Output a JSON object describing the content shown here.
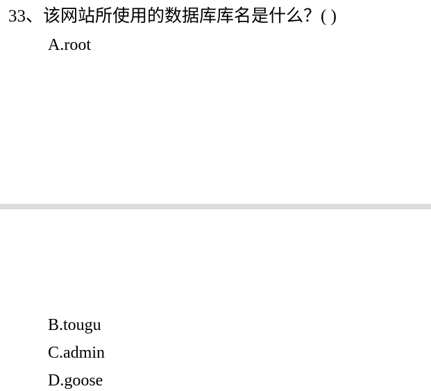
{
  "question": {
    "text": "33、该网站所使用的数据库库名是什么？(   )"
  },
  "options": [
    {
      "label": "A.root"
    },
    {
      "label": "B.tougu"
    },
    {
      "label": "C.admin"
    },
    {
      "label": "D.goose"
    }
  ],
  "colors": {
    "divider": "#dcdcdc",
    "text": "#000000",
    "background": "#ffffff"
  }
}
